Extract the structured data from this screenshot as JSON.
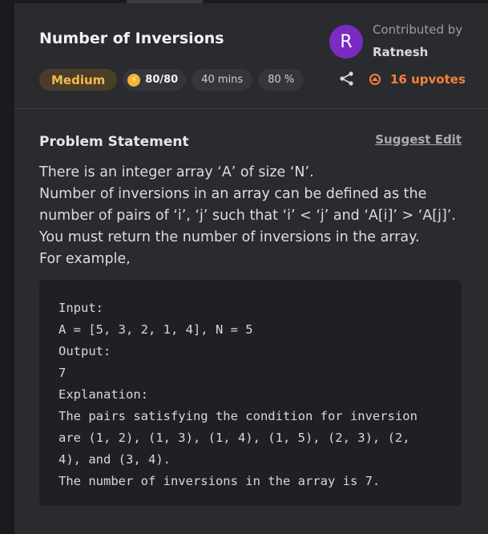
{
  "problem": {
    "title": "Number of Inversions",
    "difficulty": "Medium",
    "score": "80/80",
    "time": "40 mins",
    "success_rate": "80 %"
  },
  "contributor": {
    "label": "Contributed by",
    "name": "Ratnesh",
    "avatar_letter": "R",
    "avatar_color": "#7b2bc4"
  },
  "actions": {
    "upvotes": "16 upvotes",
    "suggest_edit": "Suggest Edit"
  },
  "statement": {
    "heading": "Problem Statement",
    "lines": [
      "There is an integer array ‘A’ of size ‘N’.",
      "Number of inversions in an array can be defined as the",
      "number of pairs of ‘i’, ‘j’ such that ‘i’ < ‘j’ and ‘A[i]’ > ‘A[j]’.",
      "You must return the number of inversions in the array.",
      "For example,"
    ]
  },
  "example": {
    "lines": [
      "Input:",
      "A = [5, 3, 2, 1, 4], N = 5",
      "Output:",
      "7",
      "Explanation:",
      "The pairs satisfying the condition for inversion",
      "are (1, 2), (1, 3), (1, 4), (1, 5), (2, 3), (2,",
      "4), and (3, 4).",
      "The number of inversions in the array is 7."
    ]
  },
  "colors": {
    "background": "#2a2b2f",
    "accent_orange": "#f6813a",
    "medium_text": "#f5b94a"
  }
}
